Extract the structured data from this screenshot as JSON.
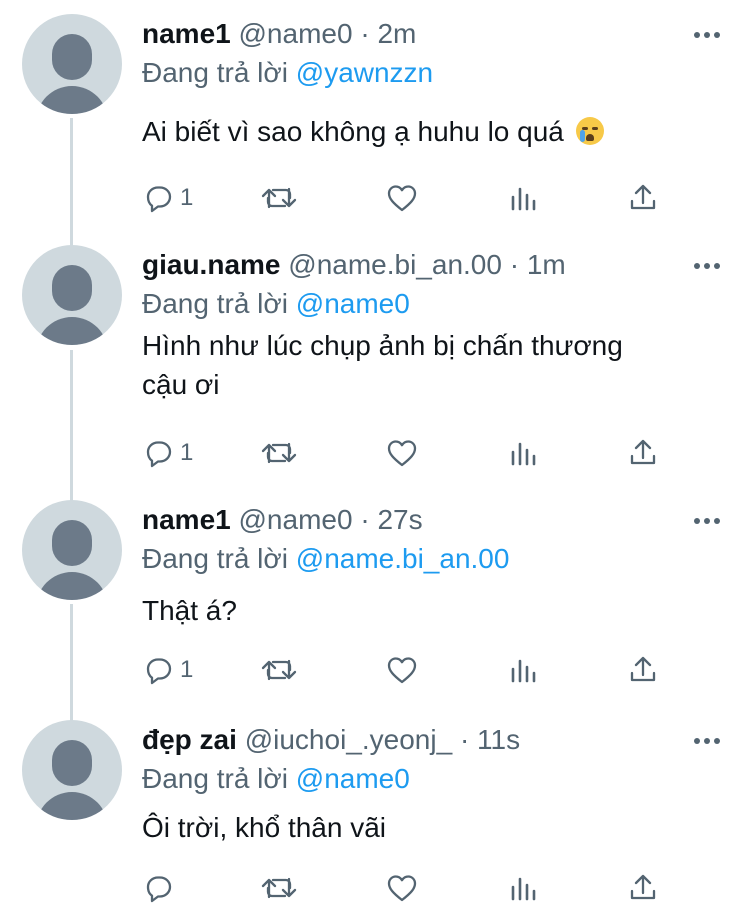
{
  "tweets": [
    {
      "name": "name1",
      "handle": "@name0",
      "separator": "·",
      "time": "2m",
      "reply_prefix": "Đang trả lời",
      "reply_to": "@yawnzzn",
      "text": "Ai biết vì sao không ạ huhu lo quá",
      "emoji": "loudly-crying-face",
      "reply_count": "1"
    },
    {
      "name": "giau.name",
      "handle": "@name.bi_an.00",
      "separator": "·",
      "time": "1m",
      "reply_prefix": "Đang trả lời",
      "reply_to": "@name0",
      "text_line1": "Hình như lúc chụp ảnh bị chấn thương",
      "text_line2": "cậu ơi",
      "reply_count": "1"
    },
    {
      "name": "name1",
      "handle": "@name0",
      "separator": "·",
      "time": "27s",
      "reply_prefix": "Đang trả lời",
      "reply_to": "@name.bi_an.00",
      "text": "Thật á?",
      "reply_count": "1"
    },
    {
      "name": "đẹp zai",
      "handle": "@iuchoi_.yeonj_",
      "separator": "·",
      "time": "11s",
      "reply_prefix": "Đang trả lời",
      "reply_to": "@name0",
      "text": "Ôi trời, khổ thân vãi",
      "reply_count": ""
    }
  ],
  "colors": {
    "accent": "#1d9bf0",
    "secondary_text": "#536471",
    "avatar_bg": "#cfd9de",
    "avatar_fg": "#6c7a89"
  }
}
